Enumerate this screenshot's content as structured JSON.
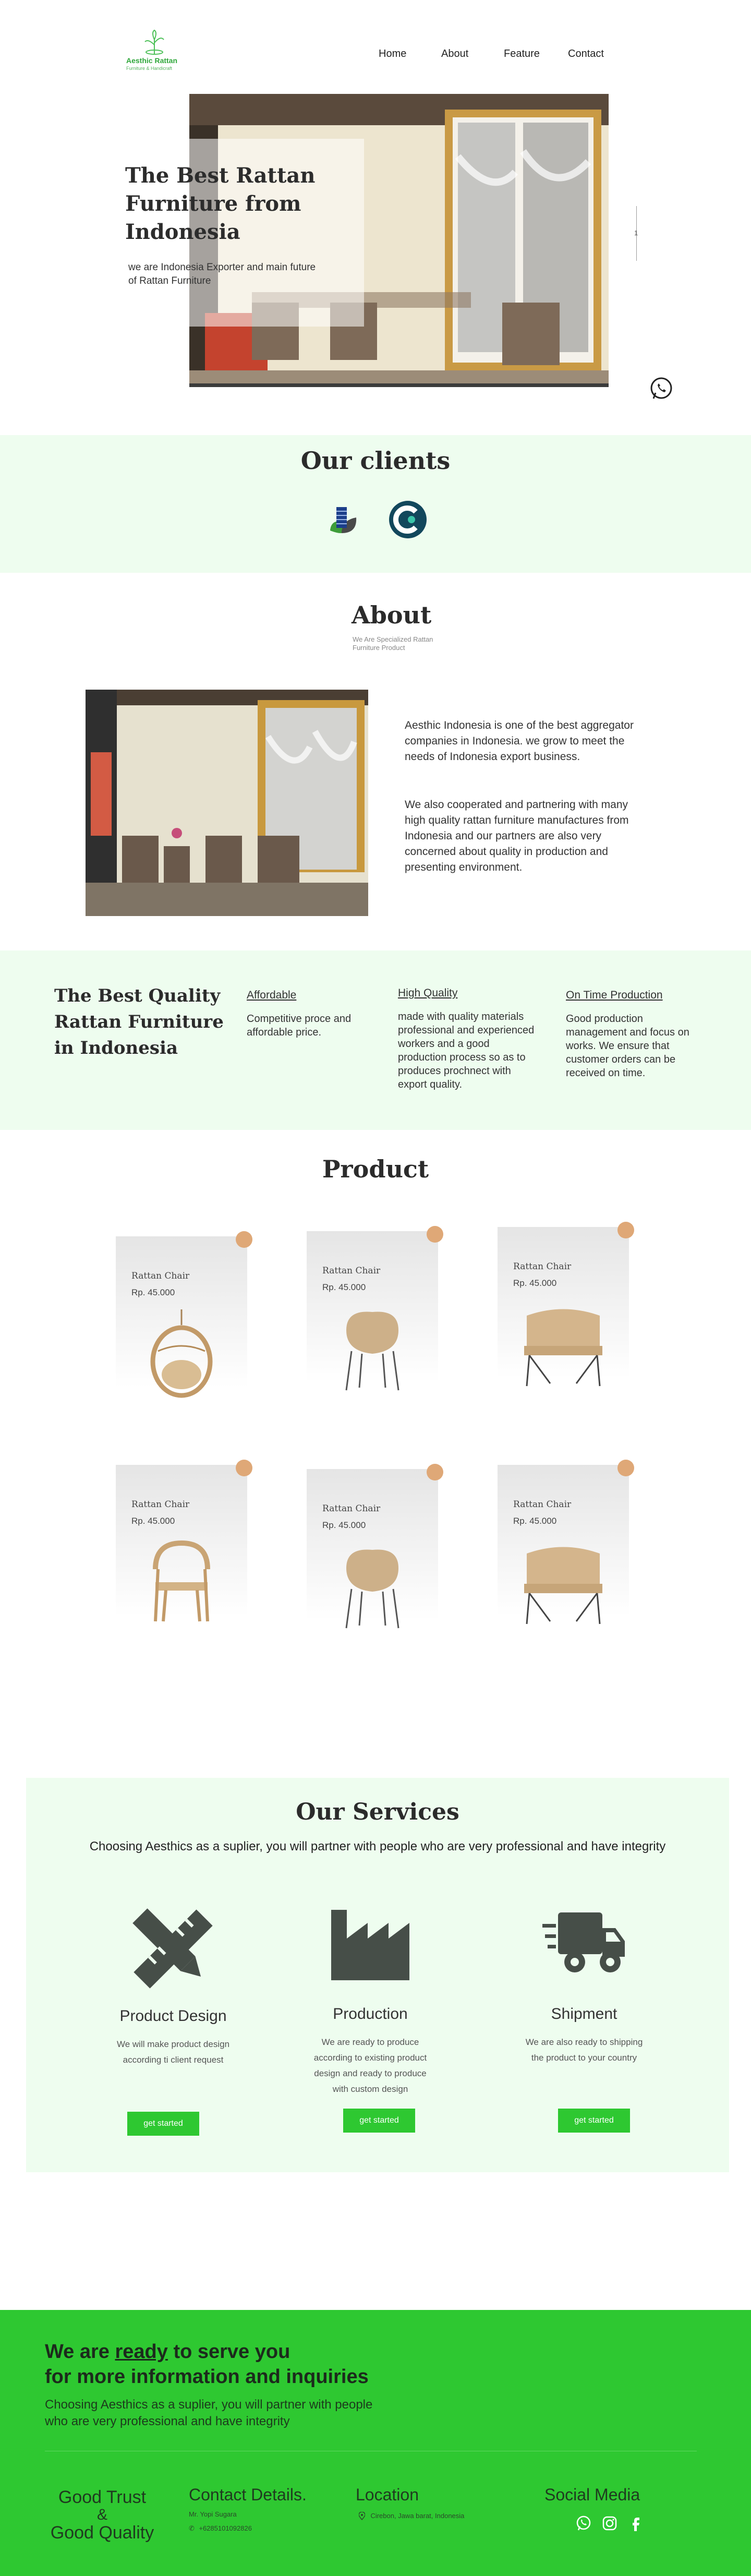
{
  "header": {
    "logo_text": "Aesthic Rattan",
    "logo_sub": "Furniture & Handicraft",
    "nav": [
      "Home",
      "About",
      "Feature",
      "Contact"
    ]
  },
  "hero": {
    "title": "The Best Rattan Furniture from Indonesia",
    "subtitle": "we are Indonesia Exporter and main future of Rattan Furniture",
    "slide_indicator": "1"
  },
  "clients": {
    "title": "Our clients"
  },
  "about": {
    "title": "About",
    "tagline": "We Are Specialized Rattan Furniture Product",
    "para1": "Aesthic Indonesia is one of the best aggregator companies in Indonesia. we grow to meet the needs of Indonesia export business.",
    "para2": "We also cooperated and partnering with many high quality rattan furniture manufactures from Indonesia and our partners are also very concerned about quality in production and presenting environment."
  },
  "quality": {
    "title": "The Best Quality Rattan Furniture in Indonesia",
    "items": [
      {
        "heading": "Affordable",
        "text": "Competitive proce and affordable price."
      },
      {
        "heading": "High Quality",
        "text": "made with quality materials professional and experienced workers and a good production process so as to produces prochnect with export quality."
      },
      {
        "heading": "On Time Production",
        "text": "Good production management and focus on works. We ensure that customer orders can be received on time."
      }
    ]
  },
  "products": {
    "title": "Product",
    "items": [
      {
        "name": "Rattan Chair",
        "price": "Rp. 45.000",
        "icon": "hanging-chair"
      },
      {
        "name": "Rattan Chair",
        "price": "Rp. 45.000",
        "icon": "shell-chair"
      },
      {
        "name": "Rattan Chair",
        "price": "Rp. 45.000",
        "icon": "bench-chair"
      },
      {
        "name": "Rattan Chair",
        "price": "Rp. 45.000",
        "icon": "arm-chair"
      },
      {
        "name": "Rattan Chair",
        "price": "Rp. 45.000",
        "icon": "shell-chair"
      },
      {
        "name": "Rattan Chair",
        "price": "Rp. 45.000",
        "icon": "bench-chair"
      }
    ]
  },
  "services": {
    "title": "Our Services",
    "subtitle": "Choosing Aesthics as a suplier, you will partner with people who are very professional and have integrity",
    "items": [
      {
        "title": "Product Design",
        "text": "We will make product design according ti client request",
        "button": "get started",
        "icon": "pencil-ruler-icon"
      },
      {
        "title": "Production",
        "text": "We are ready to produce according to existing product design and ready to produce with custom design",
        "button": "get started",
        "icon": "factory-icon"
      },
      {
        "title": "Shipment",
        "text": "We are also ready to shipping the product to your country",
        "button": "get started",
        "icon": "truck-icon"
      }
    ]
  },
  "cta": {
    "line1_pre": "We are ",
    "line1_ready": "ready",
    "line1_post": " to serve you",
    "line2": "for more information and inquiries",
    "sub1": "Choosing Aesthics as a suplier, you will partner with people",
    "sub2": "who are very professional and have integrity"
  },
  "footer": {
    "trust1": "Good Trust",
    "trust_amp": "&",
    "trust2": "Good Quality",
    "contact_title": "Contact Details.",
    "contact_name": "Mr. Yopi Sugara",
    "contact_phone": "+6285101092826",
    "location_title": "Location",
    "location_text": "Cirebon, Jawa barat, Indonesia",
    "social_title": "Social Media"
  },
  "colors": {
    "brand_green": "#2ec831",
    "mint_bg": "#eefdef",
    "product_dot": "#dfa877",
    "dark_icon": "#464e48"
  }
}
